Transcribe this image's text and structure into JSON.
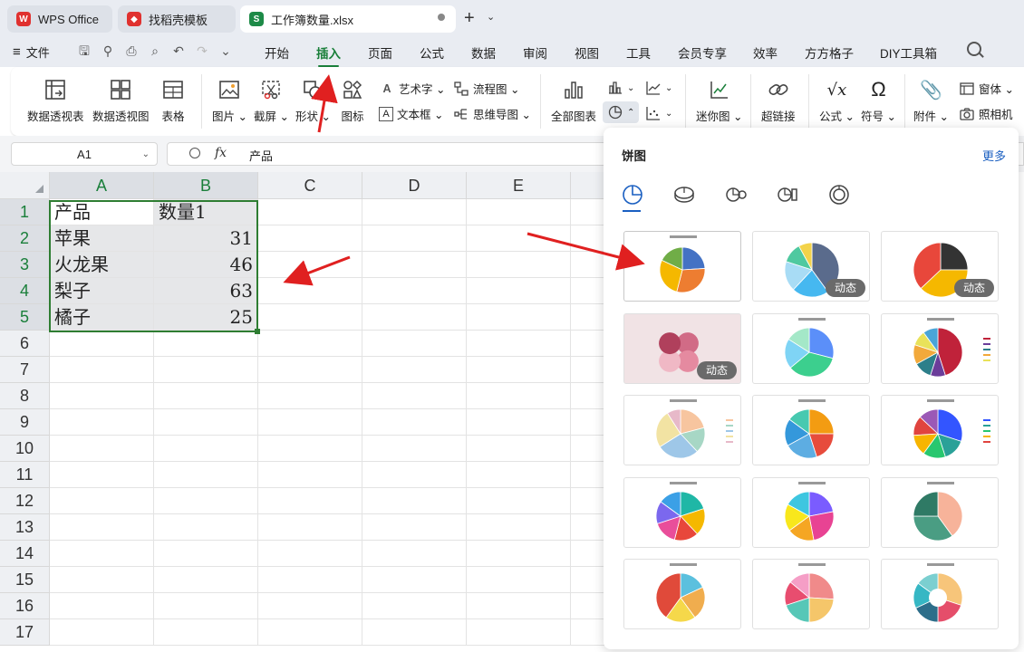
{
  "tabs": [
    {
      "label": "WPS Office",
      "icon": "wps-logo-icon",
      "color": "#e0312f"
    },
    {
      "label": "找稻壳模板",
      "icon": "docer-logo-icon",
      "color": "#e0312f"
    },
    {
      "label": "工作簿数量.xlsx",
      "icon": "spreadsheet-logo-icon",
      "color": "#1d8a47"
    }
  ],
  "menu": {
    "file": "文件",
    "tabs": [
      "开始",
      "插入",
      "页面",
      "公式",
      "数据",
      "审阅",
      "视图",
      "工具",
      "会员专享",
      "效率",
      "方方格子",
      "DIY工具箱"
    ],
    "active": "插入"
  },
  "ribbon": {
    "pivot_table": "数据透视表",
    "pivot_chart": "数据透视图",
    "table": "表格",
    "picture": "图片",
    "screenshot": "截屏",
    "shape": "形状",
    "icons": "图标",
    "wordart": "艺术字",
    "textbox": "文本框",
    "flowchart": "流程图",
    "mindmap": "思维导图",
    "all_charts": "全部图表",
    "sparkline": "迷你图",
    "hyperlink": "超链接",
    "formula": "公式",
    "symbol": "符号",
    "attachment": "附件",
    "form": "窗体",
    "camera": "照相机"
  },
  "formula_bar": {
    "cell_ref": "A1",
    "fx": "fx",
    "value": "产品"
  },
  "sheet": {
    "columns": [
      "A",
      "B",
      "C",
      "D",
      "E"
    ],
    "rows": [
      "1",
      "2",
      "3",
      "4",
      "5",
      "6",
      "7",
      "8",
      "9",
      "10",
      "11",
      "12",
      "13",
      "14",
      "15",
      "16",
      "17"
    ],
    "data": [
      [
        "产品",
        "数量1"
      ],
      [
        "苹果",
        "31"
      ],
      [
        "火龙果",
        "46"
      ],
      [
        "梨子",
        "63"
      ],
      [
        "橘子",
        "25"
      ]
    ]
  },
  "pie_panel": {
    "title": "饼图",
    "more": "更多",
    "types": [
      "pie-type-icon",
      "pie-3d-type-icon",
      "pie-of-pie-type-icon",
      "bar-of-pie-type-icon",
      "doughnut-type-icon"
    ],
    "dynamic_badge": "动态",
    "templates": [
      {
        "badge": false,
        "colors": [
          "#4472c4",
          "#ed7d31",
          "#f5b800",
          "#70ad47",
          "#5b9bd5"
        ],
        "values": [
          24,
          30,
          28,
          18
        ]
      },
      {
        "badge": true,
        "colors": [
          "#5a6b8c",
          "#46b8f0",
          "#a8dcf5",
          "#4fc9a0",
          "#f3d34a"
        ],
        "values": [
          40,
          22,
          18,
          12,
          8
        ]
      },
      {
        "badge": true,
        "colors": [
          "#333333",
          "#f5b800",
          "#e8473b"
        ],
        "values": [
          25,
          38,
          37
        ]
      },
      {
        "badge": true,
        "colors": [
          "#d16b86",
          "#e58aa0",
          "#f0b8c5",
          "#b0405c"
        ],
        "values": [
          25,
          25,
          25,
          25
        ]
      },
      {
        "badge": false,
        "colors": [
          "#5b8ff9",
          "#3ccf8e",
          "#7fd4f5",
          "#a4e8c8"
        ],
        "values": [
          29,
          35,
          20,
          16
        ]
      },
      {
        "badge": false,
        "colors": [
          "#c0223a",
          "#6b3d9a",
          "#2d7f8a",
          "#f2a93b",
          "#e9e25a",
          "#4aa5d8"
        ],
        "values": [
          45,
          10,
          12,
          13,
          10,
          10
        ]
      },
      {
        "badge": false,
        "colors": [
          "#f7c59f",
          "#a7d7c5",
          "#9ec7e8",
          "#f2e3a3",
          "#e7b9c9"
        ],
        "values": [
          21,
          17,
          28,
          25,
          9
        ]
      },
      {
        "badge": false,
        "colors": [
          "#f39c12",
          "#e74c3c",
          "#5dade2",
          "#3498db",
          "#48c9b0"
        ],
        "values": [
          25,
          20,
          22,
          18,
          15
        ]
      },
      {
        "badge": false,
        "colors": [
          "#3355ff",
          "#2aa198",
          "#28c76f",
          "#f7b500",
          "#e0443f",
          "#9b59b6"
        ],
        "values": [
          30,
          15,
          15,
          14,
          13,
          13
        ]
      },
      {
        "badge": false,
        "colors": [
          "#1fb7a6",
          "#f5b800",
          "#e8473b",
          "#e94e9a",
          "#7b68ee",
          "#3ba0e6"
        ],
        "values": [
          20,
          18,
          16,
          16,
          15,
          15
        ]
      },
      {
        "badge": false,
        "colors": [
          "#7a5cff",
          "#e84393",
          "#f5a623",
          "#f8e71c",
          "#3ec6e0"
        ],
        "values": [
          22,
          25,
          18,
          18,
          17
        ]
      },
      {
        "badge": false,
        "colors": [
          "#f7b39a",
          "#4a9d83",
          "#2f7a65"
        ],
        "values": [
          40,
          35,
          25
        ]
      },
      {
        "badge": false,
        "colors": [
          "#5bc0de",
          "#f0ad4e",
          "#f5d84a",
          "#e04a3a"
        ],
        "values": [
          18,
          22,
          20,
          40
        ]
      },
      {
        "badge": false,
        "colors": [
          "#f08a8a",
          "#f5c66a",
          "#57c7b7",
          "#e84d6f",
          "#f59ec6"
        ],
        "values": [
          26,
          24,
          20,
          16,
          14
        ]
      },
      {
        "badge": false,
        "colors": [
          "#f7c57a",
          "#e54e6a",
          "#2d6e8a",
          "#36b7c4",
          "#7bcfd0"
        ],
        "values": [
          30,
          20,
          18,
          17,
          15
        ]
      }
    ]
  }
}
